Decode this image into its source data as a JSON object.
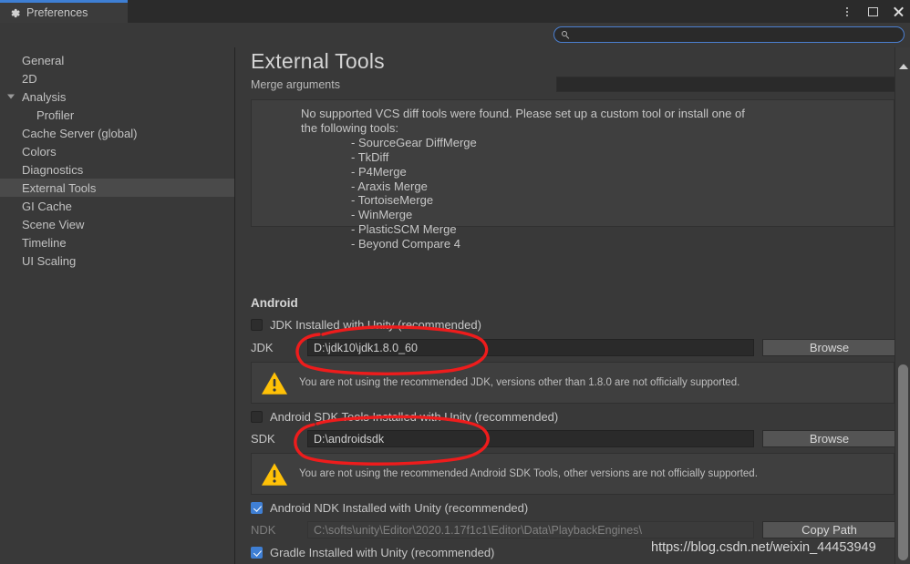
{
  "window": {
    "tab_label": "Preferences",
    "tab_icon": "gear-icon",
    "controls": {
      "menu": "kebab-menu-icon",
      "maximize": "maximize-icon",
      "close": "close-icon"
    }
  },
  "search": {
    "value": "",
    "placeholder": "",
    "icon": "search-icon"
  },
  "sidebar": {
    "items": [
      {
        "label": "General",
        "selected": false,
        "child": false,
        "expandable": false
      },
      {
        "label": "2D",
        "selected": false,
        "child": false,
        "expandable": false
      },
      {
        "label": "Analysis",
        "selected": false,
        "child": false,
        "expandable": true
      },
      {
        "label": "Profiler",
        "selected": false,
        "child": true,
        "expandable": false
      },
      {
        "label": "Cache Server (global)",
        "selected": false,
        "child": false,
        "expandable": false
      },
      {
        "label": "Colors",
        "selected": false,
        "child": false,
        "expandable": false
      },
      {
        "label": "Diagnostics",
        "selected": false,
        "child": false,
        "expandable": false
      },
      {
        "label": "External Tools",
        "selected": true,
        "child": false,
        "expandable": false
      },
      {
        "label": "GI Cache",
        "selected": false,
        "child": false,
        "expandable": false
      },
      {
        "label": "Scene View",
        "selected": false,
        "child": false,
        "expandable": false
      },
      {
        "label": "Timeline",
        "selected": false,
        "child": false,
        "expandable": false
      },
      {
        "label": "UI Scaling",
        "selected": false,
        "child": false,
        "expandable": false
      }
    ]
  },
  "main": {
    "title": "External Tools",
    "merge_arguments": {
      "label": "Merge arguments",
      "value": ""
    },
    "vcs_help": {
      "line1": "No supported VCS diff tools were found. Please set up a custom tool or install one of",
      "line2": "the following tools:",
      "tools": [
        "- SourceGear DiffMerge",
        "- TkDiff",
        "- P4Merge",
        "- Araxis Merge",
        "- TortoiseMerge",
        "- WinMerge",
        "- PlasticSCM Merge",
        "- Beyond Compare 4"
      ]
    },
    "android": {
      "section_label": "Android",
      "jdk": {
        "checkbox_label": "JDK Installed with Unity (recommended)",
        "checked": false,
        "path_label": "JDK",
        "path_value": "D:\\jdk10\\jdk1.8.0_60",
        "button_label": "Browse",
        "warning": "You are not using the recommended JDK, versions other than 1.8.0 are not officially supported.",
        "warning_icon": "warning-triangle-icon"
      },
      "sdk": {
        "checkbox_label": "Android SDK Tools Installed with Unity (recommended)",
        "checked": false,
        "path_label": "SDK",
        "path_value": "D:\\androidsdk",
        "button_label": "Browse",
        "warning": "You are not using the recommended Android SDK Tools, other versions are not officially supported.",
        "warning_icon": "warning-triangle-icon"
      },
      "ndk": {
        "checkbox_label": "Android NDK Installed with Unity (recommended)",
        "checked": true,
        "path_label": "NDK",
        "path_value": "C:\\softs\\unity\\Editor\\2020.1.17f1c1\\Editor\\Data\\PlaybackEngines\\",
        "button_label": "Copy Path"
      },
      "gradle": {
        "checkbox_label": "Gradle Installed with Unity (recommended)",
        "checked": true
      }
    }
  },
  "annotations": {
    "circles": [
      {
        "name": "jdk-path-highlight",
        "color": "#ee1c1c"
      },
      {
        "name": "sdk-path-highlight",
        "color": "#ee1c1c"
      }
    ],
    "watermark": "https://blog.csdn.net/weixin_44453949"
  },
  "colors": {
    "accent": "#3e7fd4",
    "background": "#393939",
    "panel": "#3f3f3f",
    "warning": "#ffc107",
    "annotation": "#ee1c1c"
  }
}
